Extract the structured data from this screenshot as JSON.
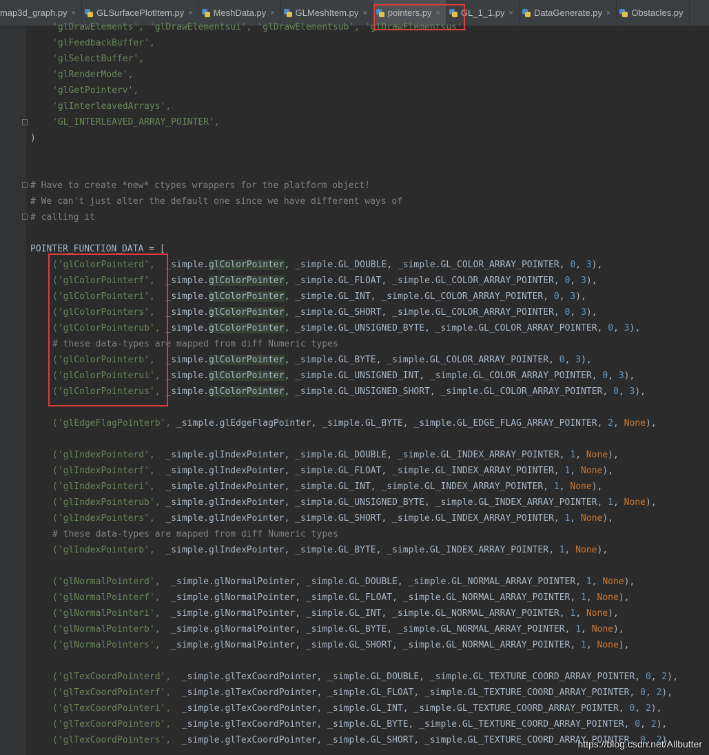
{
  "tabs": [
    {
      "label": "map3d_graph.py",
      "active": false
    },
    {
      "label": "GLSurfacePlotItem.py",
      "active": false
    },
    {
      "label": "MeshData.py",
      "active": false
    },
    {
      "label": "GLMeshItem.py",
      "active": false
    },
    {
      "label": "pointers.py",
      "active": true
    },
    {
      "label": "GL_1_1.py",
      "active": false
    },
    {
      "label": "DataGenerate.py",
      "active": false
    },
    {
      "label": "Obstacles.py",
      "active": false
    }
  ],
  "close_glyph": "×",
  "colors": {
    "background": "#2b2b2b",
    "comment": "#808080",
    "string": "#6a8759",
    "number": "#6897bb",
    "keyword": "#cc7832",
    "annotation_box": "#e03b3b"
  },
  "code": {
    "l0": "'glDrawElements', 'glDrawElementsui', 'glDrawElementsub', 'glDrawElementsus',",
    "l1": "'glFeedbackBuffer',",
    "l2": "'glSelectBuffer',",
    "l3": "'glRenderMode',",
    "l4": "'glGetPointerv',",
    "l5": "'glInterleavedArrays',",
    "l6": "'GL_INTERLEAVED_ARRAY_POINTER',",
    "l7": ")",
    "c1": "# Have to create *new* ctypes wrappers for the platform object!",
    "c2": "# We can't just alter the default one since we have different ways of",
    "c3": "# calling it",
    "decl": "POINTER_FUNCTION_DATA = [",
    "cp": [
      [
        "('glColorPointerd',",
        "_simple.",
        "glColorPointer",
        ", _simple.GL_DOUBLE, _simple.GL_COLOR_ARRAY_POINTER, ",
        "0",
        ", ",
        "3",
        "),"
      ],
      [
        "('glColorPointerf',",
        "_simple.",
        "glColorPointer",
        ", _simple.GL_FLOAT, _simple.GL_COLOR_ARRAY_POINTER, ",
        "0",
        ", ",
        "3",
        "),"
      ],
      [
        "('glColorPointeri',",
        "_simple.",
        "glColorPointer",
        ", _simple.GL_INT, _simple.GL_COLOR_ARRAY_POINTER, ",
        "0",
        ", ",
        "3",
        "),"
      ],
      [
        "('glColorPointers',",
        "_simple.",
        "glColorPointer",
        ", _simple.GL_SHORT, _simple.GL_COLOR_ARRAY_POINTER, ",
        "0",
        ", ",
        "3",
        "),"
      ],
      [
        "('glColorPointerub',",
        "_simple.",
        "glColorPointer",
        ", _simple.GL_UNSIGNED_BYTE, _simple.GL_COLOR_ARRAY_POINTER, ",
        "0",
        ", ",
        "3",
        "),"
      ]
    ],
    "cmt_mapped_1": "# these data-types are mapped from diff Numeric types",
    "cp2": [
      [
        "('glColorPointerb',",
        "_simple.",
        "glColorPointer",
        ", _simple.GL_BYTE, _simple.GL_COLOR_ARRAY_POINTER, ",
        "0",
        ", ",
        "3",
        "),"
      ],
      [
        "('glColorPointerui',",
        "_simple.",
        "glColorPointer",
        ", _simple.GL_UNSIGNED_INT, _simple.GL_COLOR_ARRAY_POINTER, ",
        "0",
        ", ",
        "3",
        "),"
      ],
      [
        "('glColorPointerus',",
        "_simple.",
        "glColorPointer",
        ", _simple.GL_UNSIGNED_SHORT, _simple.GL_COLOR_ARRAY_POINTER, ",
        "0",
        ", ",
        "3",
        "),"
      ]
    ],
    "edge": [
      "('glEdgeFlagPointerb',",
      " _simple.glEdgeFlagPointer, _simple.GL_BYTE, _simple.GL_EDGE_FLAG_ARRAY_POINTER, ",
      "2",
      ", ",
      "None",
      "),"
    ],
    "ip": [
      [
        "('glIndexPointerd',",
        "  _simple.glIndexPointer, _simple.GL_DOUBLE, _simple.GL_INDEX_ARRAY_POINTER, ",
        "1",
        ", ",
        "None",
        "),"
      ],
      [
        "('glIndexPointerf',",
        "  _simple.glIndexPointer, _simple.GL_FLOAT, _simple.GL_INDEX_ARRAY_POINTER, ",
        "1",
        ", ",
        "None",
        "),"
      ],
      [
        "('glIndexPointeri',",
        "  _simple.glIndexPointer, _simple.GL_INT, _simple.GL_INDEX_ARRAY_POINTER, ",
        "1",
        ", ",
        "None",
        "),"
      ],
      [
        "('glIndexPointerub',",
        " _simple.glIndexPointer, _simple.GL_UNSIGNED_BYTE, _simple.GL_INDEX_ARRAY_POINTER, ",
        "1",
        ", ",
        "None",
        "),"
      ],
      [
        "('glIndexPointers',",
        "  _simple.glIndexPointer, _simple.GL_SHORT, _simple.GL_INDEX_ARRAY_POINTER, ",
        "1",
        ", ",
        "None",
        "),"
      ]
    ],
    "cmt_mapped_2": "# these data-types are mapped from diff Numeric types",
    "ip2": [
      "('glIndexPointerb',",
      "  _simple.glIndexPointer, _simple.GL_BYTE, _simple.GL_INDEX_ARRAY_POINTER, ",
      "1",
      ", ",
      "None",
      "),"
    ],
    "np": [
      [
        "('glNormalPointerd',",
        "  _simple.glNormalPointer, _simple.GL_DOUBLE, _simple.GL_NORMAL_ARRAY_POINTER, ",
        "1",
        ", ",
        "None",
        "),"
      ],
      [
        "('glNormalPointerf',",
        "  _simple.glNormalPointer, _simple.GL_FLOAT, _simple.GL_NORMAL_ARRAY_POINTER, ",
        "1",
        ", ",
        "None",
        "),"
      ],
      [
        "('glNormalPointeri',",
        "  _simple.glNormalPointer, _simple.GL_INT, _simple.GL_NORMAL_ARRAY_POINTER, ",
        "1",
        ", ",
        "None",
        "),"
      ],
      [
        "('glNormalPointerb',",
        "  _simple.glNormalPointer, _simple.GL_BYTE, _simple.GL_NORMAL_ARRAY_POINTER, ",
        "1",
        ", ",
        "None",
        "),"
      ],
      [
        "('glNormalPointers',",
        "  _simple.glNormalPointer, _simple.GL_SHORT, _simple.GL_NORMAL_ARRAY_POINTER, ",
        "1",
        ", ",
        "None",
        "),"
      ]
    ],
    "tp": [
      [
        "('glTexCoordPointerd',",
        "  _simple.glTexCoordPointer, _simple.GL_DOUBLE, _simple.GL_TEXTURE_COORD_ARRAY_POINTER, ",
        "0",
        ", ",
        "2",
        "),"
      ],
      [
        "('glTexCoordPointerf',",
        "  _simple.glTexCoordPointer, _simple.GL_FLOAT, _simple.GL_TEXTURE_COORD_ARRAY_POINTER, ",
        "0",
        ", ",
        "2",
        "),"
      ],
      [
        "('glTexCoordPointeri',",
        "  _simple.glTexCoordPointer, _simple.GL_INT, _simple.GL_TEXTURE_COORD_ARRAY_POINTER, ",
        "0",
        ", ",
        "2",
        "),"
      ],
      [
        "('glTexCoordPointerb',",
        "  _simple.glTexCoordPointer, _simple.GL_BYTE, _simple.GL_TEXTURE_COORD_ARRAY_POINTER, ",
        "0",
        ", ",
        "2",
        "),"
      ],
      [
        "('glTexCoordPointers',",
        "  _simple.glTexCoordPointer, _simple.GL_SHORT, _simple.GL_TEXTURE_COORD_ARRAY_POINTER, ",
        "0",
        ", ",
        "2",
        "),"
      ]
    ]
  },
  "watermark": "https://blog.csdn.net/Allbutter"
}
